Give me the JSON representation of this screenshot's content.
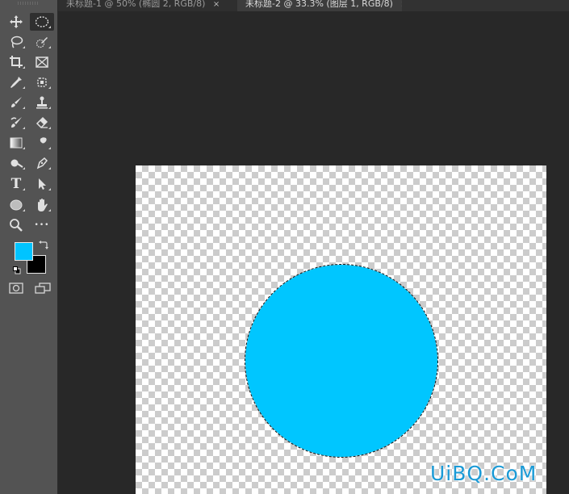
{
  "tabs": [
    {
      "label": "未标题-1 @ 50% (椭圆 2, RGB/8)",
      "close": "×"
    },
    {
      "label": "未标题-2 @ 33.3% (图层 1, RGB/8)",
      "close": "×"
    }
  ],
  "tools": [
    {
      "name": "move-tool",
      "icon": "move-icon"
    },
    {
      "name": "elliptical-marquee-tool",
      "icon": "elliptical-marquee-icon",
      "active": true
    },
    {
      "name": "lasso-tool",
      "icon": "lasso-icon"
    },
    {
      "name": "quick-selection-tool",
      "icon": "quick-selection-icon"
    },
    {
      "name": "crop-tool",
      "icon": "crop-icon"
    },
    {
      "name": "frame-tool",
      "icon": "frame-icon"
    },
    {
      "name": "eyedropper-tool",
      "icon": "eyedropper-icon"
    },
    {
      "name": "spot-healing-tool",
      "icon": "spot-healing-icon"
    },
    {
      "name": "brush-tool",
      "icon": "brush-icon"
    },
    {
      "name": "clone-stamp-tool",
      "icon": "stamp-icon"
    },
    {
      "name": "history-brush-tool",
      "icon": "history-brush-icon"
    },
    {
      "name": "eraser-tool",
      "icon": "eraser-icon"
    },
    {
      "name": "gradient-tool",
      "icon": "gradient-icon"
    },
    {
      "name": "smudge-tool",
      "icon": "smudge-icon"
    },
    {
      "name": "dodge-tool",
      "icon": "dodge-icon"
    },
    {
      "name": "pen-tool",
      "icon": "pen-icon"
    },
    {
      "name": "type-tool",
      "icon": "type-icon",
      "glyph": "T"
    },
    {
      "name": "path-selection-tool",
      "icon": "arrow-icon"
    },
    {
      "name": "ellipse-tool",
      "icon": "ellipse-shape-icon"
    },
    {
      "name": "hand-tool",
      "icon": "hand-icon"
    },
    {
      "name": "zoom-tool",
      "icon": "zoom-icon"
    },
    {
      "name": "more-tools",
      "icon": "more-icon",
      "glyph": "•••"
    }
  ],
  "colors": {
    "foreground": "#00c4ff",
    "background": "#000000",
    "circle_fill": "#00c6ff"
  },
  "watermark": "UiBQ.CoM"
}
